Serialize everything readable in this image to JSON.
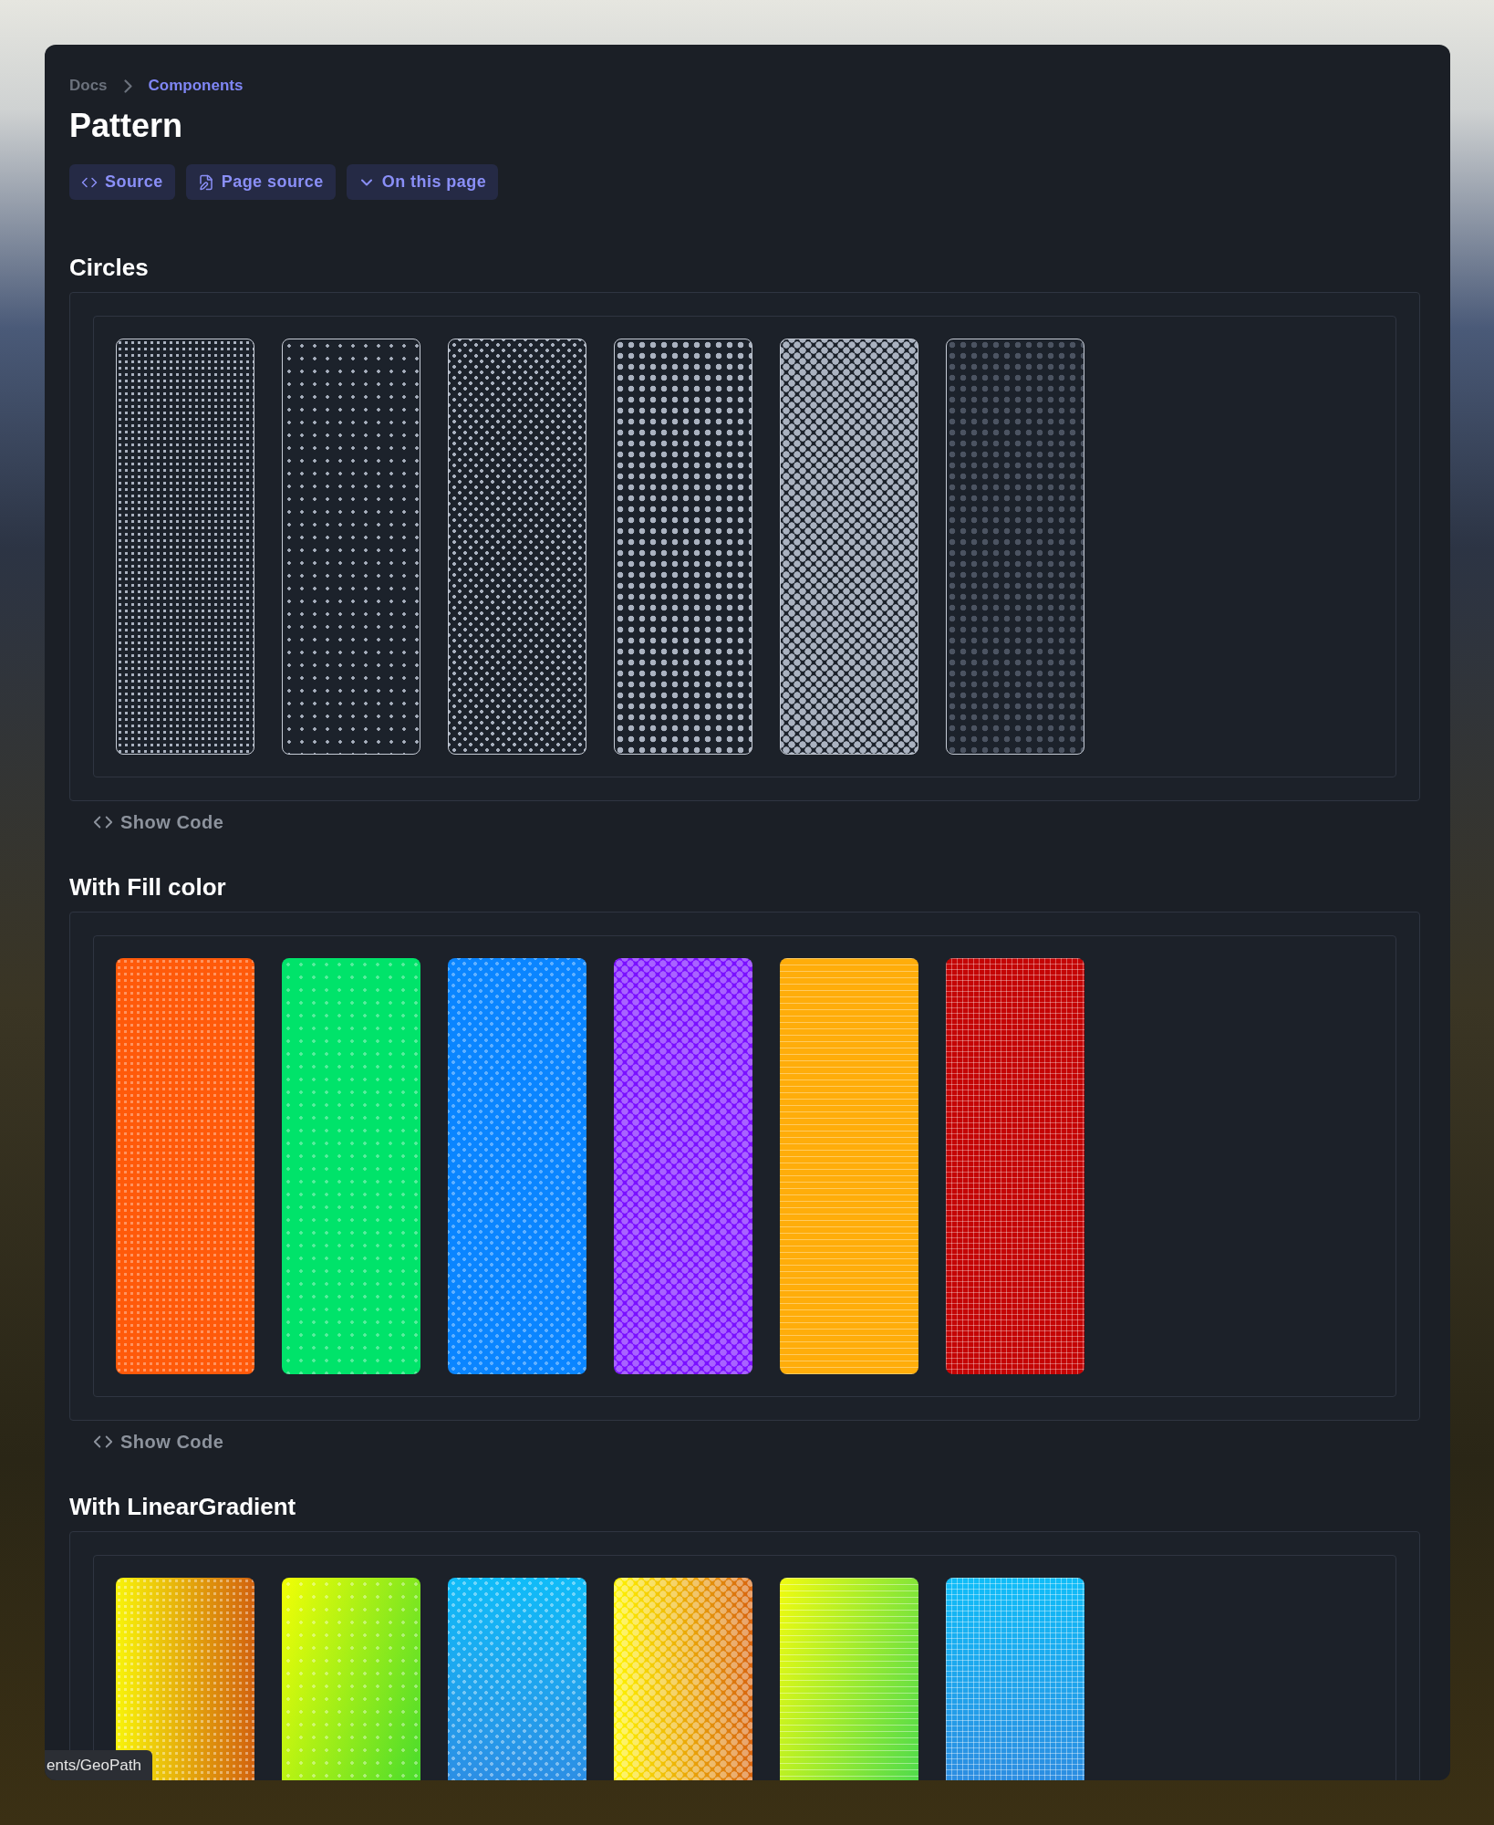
{
  "breadcrumb": [
    {
      "label": "Docs",
      "selected": false
    },
    {
      "label": "Components",
      "selected": true
    }
  ],
  "title": "Pattern",
  "actions": [
    {
      "kind": "code",
      "label": "Source"
    },
    {
      "kind": "file",
      "label": "Page source"
    },
    {
      "kind": "chevron",
      "label": "On this page"
    }
  ],
  "sections": [
    {
      "title": "Circles",
      "kind": "outline",
      "show_code": "Show Code",
      "tiles": [
        {
          "kind": "fine-dots"
        },
        {
          "kind": "sparse-dots"
        },
        {
          "kind": "staggered-dots"
        },
        {
          "kind": "large-dots"
        },
        {
          "kind": "dense-staggered"
        },
        {
          "kind": "dim-dots"
        }
      ]
    },
    {
      "title": "With Fill color",
      "kind": "fill",
      "show_code": "Show Code",
      "tiles": [
        {
          "kind": "fine-dots",
          "color": "#ff5a0a"
        },
        {
          "kind": "sparse-dots",
          "color": "#00e36a"
        },
        {
          "kind": "staggered-dots",
          "color": "#0a85ff"
        },
        {
          "kind": "dense-staggered",
          "color": "#7a10ff"
        },
        {
          "kind": "lines",
          "color": "#ffad0a"
        },
        {
          "kind": "grid",
          "color": "#c40505"
        }
      ]
    },
    {
      "title": "With LinearGradient",
      "kind": "gradient",
      "tiles": [
        {
          "kind": "fine-dots"
        },
        {
          "kind": "sparse-dots"
        },
        {
          "kind": "staggered-dots"
        },
        {
          "kind": "dense-staggered"
        },
        {
          "kind": "lines"
        },
        {
          "kind": "grid"
        }
      ]
    }
  ],
  "status_url": "ents/GeoPath"
}
